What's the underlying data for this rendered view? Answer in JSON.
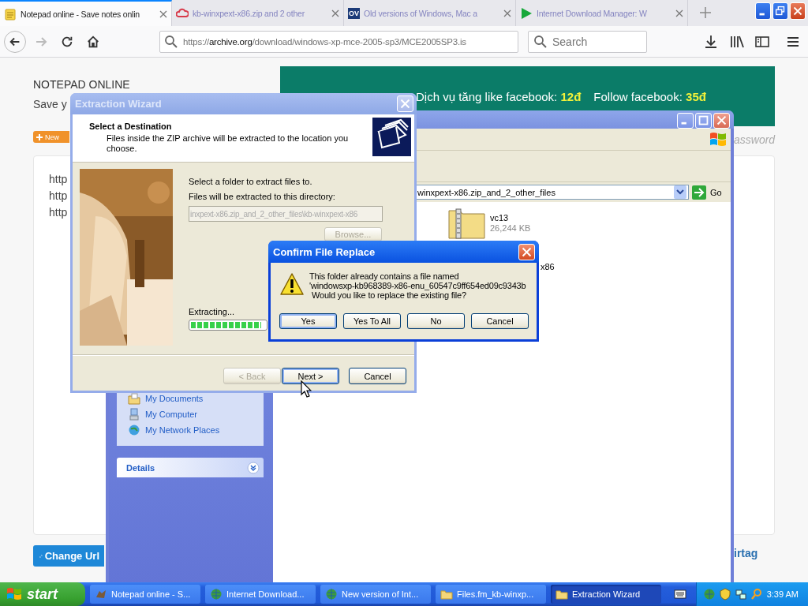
{
  "browser": {
    "tabs": [
      {
        "label": "Notepad online - Save notes onlin",
        "selected": true,
        "kind": "note"
      },
      {
        "label": "kb-winxpext-x86.zip and 2 other",
        "selected": false,
        "kind": "cloud"
      },
      {
        "label": "Old versions of Windows, Mac a",
        "selected": false,
        "kind": "badge",
        "icon_text": "OV"
      },
      {
        "label": "Internet Download Manager: W",
        "selected": false,
        "kind": "play"
      }
    ],
    "nav": {
      "back_disabled": false,
      "forward_disabled": true,
      "url_scheme": "https://",
      "url_host": "archive.org",
      "url_path": "/download/windows-xp-mce-2005-sp3/MCE2005SP3.is",
      "search_placeholder": "Search"
    }
  },
  "page": {
    "title": "NOTEPAD ONLINE",
    "subtitle": "Save y",
    "new_button": "New",
    "offers": [
      {
        "label": "Dịch vụ tăng like facebook:",
        "price": "12đ"
      },
      {
        "label": "Follow facebook:",
        "price": "35đ"
      }
    ],
    "lines": [
      "http",
      "http",
      "http"
    ],
    "password_link": "assword",
    "change_url_button": "Change Url",
    "tag_link": "irtag"
  },
  "explorer": {
    "address": "winxpext-x86.zip_and_2_other_files",
    "go_button": "Go",
    "places": [
      {
        "label": "My Documents",
        "kind": "documents"
      },
      {
        "label": "My Computer",
        "kind": "computer"
      },
      {
        "label": "My Network Places",
        "kind": "network"
      }
    ],
    "details": "Details",
    "files": [
      {
        "name": "vc13",
        "size": "26,244 KB"
      },
      {
        "name": "x86"
      }
    ]
  },
  "wizard": {
    "title": "Extraction Wizard",
    "heading": "Select a Destination",
    "description": "Files inside the ZIP archive will be extracted to the location you choose.",
    "prompt": "Select a folder to extract files to.",
    "dir_label": "Files will be extracted to this directory:",
    "dir_value": "inxpext-x86.zip_and_2_other_files\\kb-winxpext-x86",
    "browse": {
      "label": "Browse...",
      "disabled": true
    },
    "progress_label": "Extracting...",
    "progress": {
      "level": 0.95
    },
    "buttons": [
      {
        "label": "< Back",
        "disabled": true,
        "default": false
      },
      {
        "label": "Next >",
        "disabled": false,
        "default": true
      },
      {
        "label": "Cancel",
        "disabled": false,
        "default": false
      }
    ]
  },
  "confirm": {
    "title": "Confirm File Replace",
    "message": [
      "This folder already contains a file named",
      "'windowsxp-kb968389-x86-enu_60547c9ff654ed09c9343b",
      "Would you like to replace the existing file?"
    ],
    "buttons": [
      {
        "label": "Yes",
        "default": true
      },
      {
        "label": "Yes To All",
        "default": false
      },
      {
        "label": "No",
        "default": false
      },
      {
        "label": "Cancel",
        "default": false
      }
    ]
  },
  "taskbar": {
    "start": "start",
    "items": [
      {
        "label": "Notepad online - S...",
        "kind": "app",
        "selected": false
      },
      {
        "label": "Internet Download...",
        "kind": "globe",
        "selected": false
      },
      {
        "label": "New version of Int...",
        "kind": "globe",
        "selected": false
      },
      {
        "label": "Files.fm_kb-winxp...",
        "kind": "folder",
        "selected": false
      },
      {
        "label": "Extraction Wizard",
        "kind": "folder",
        "selected": true
      }
    ],
    "clock": "3:39 AM"
  }
}
